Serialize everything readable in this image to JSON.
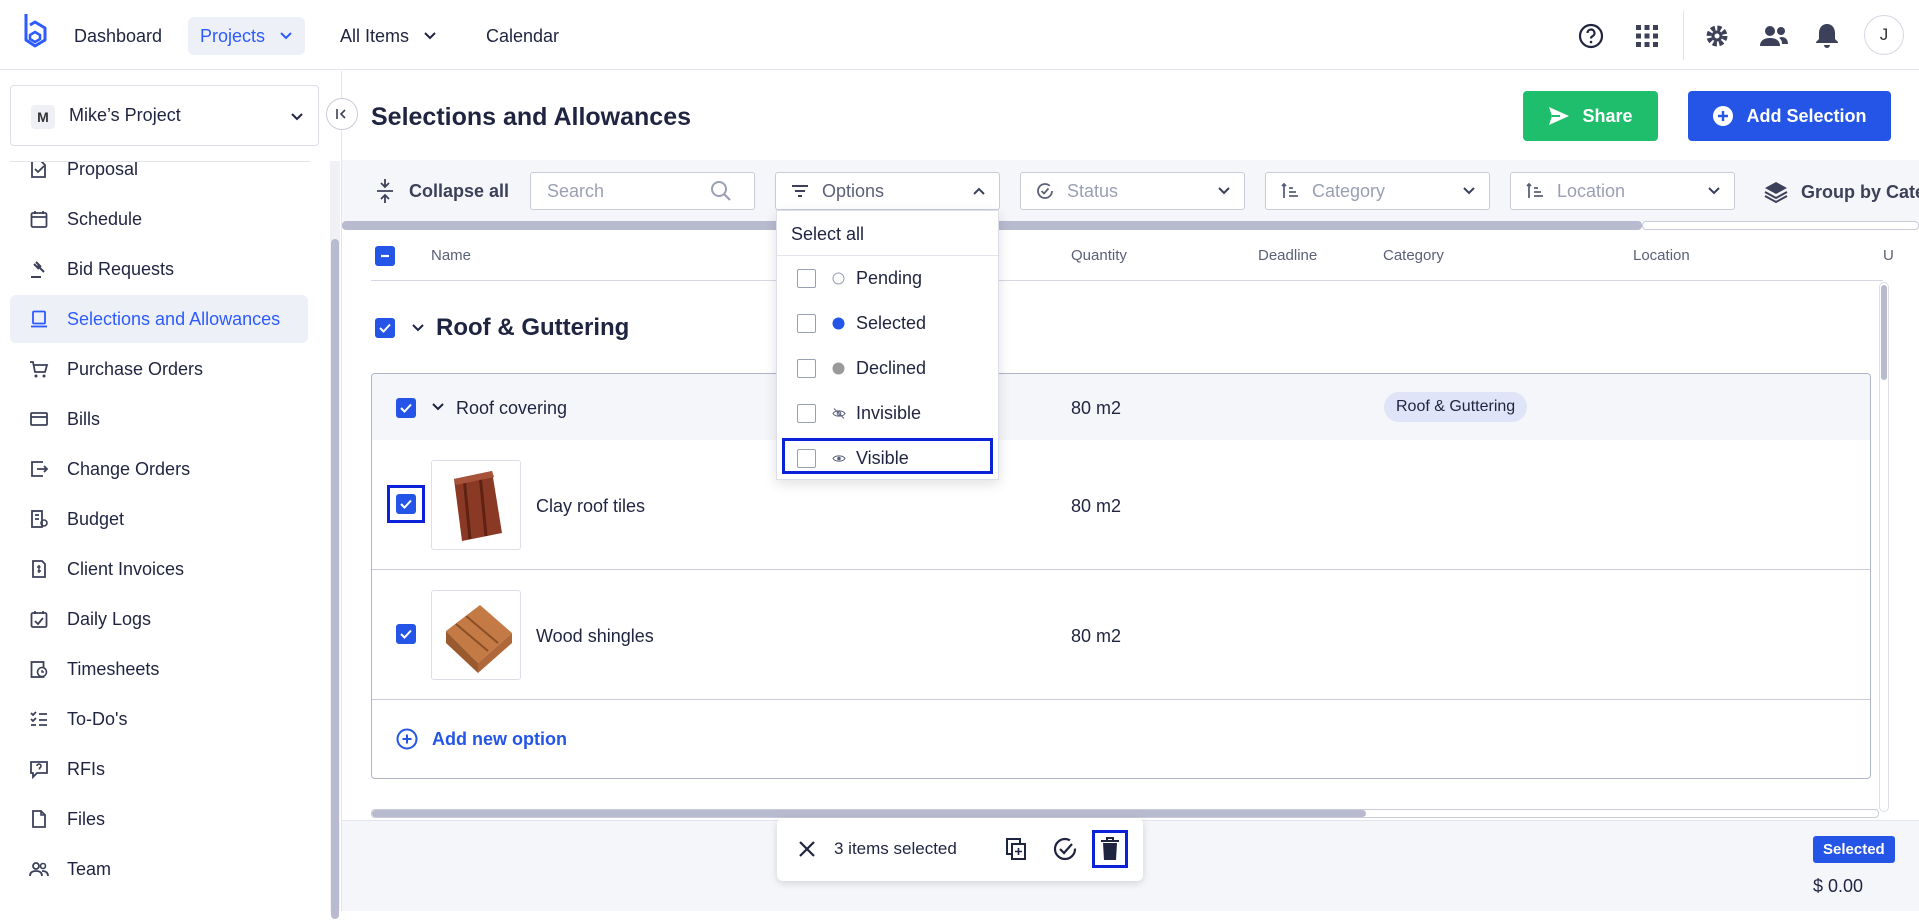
{
  "topnav": {
    "dashboard": "Dashboard",
    "projects": "Projects",
    "all_items": "All Items",
    "calendar": "Calendar",
    "avatar_initial": "J"
  },
  "sidebar": {
    "project_initial": "M",
    "project_name": "Mike’s Project",
    "items": [
      {
        "label": "Proposal",
        "icon": "proposal-icon"
      },
      {
        "label": "Schedule",
        "icon": "calendar-icon"
      },
      {
        "label": "Bid Requests",
        "icon": "gavel-icon"
      },
      {
        "label": "Selections and Allowances",
        "icon": "selections-icon",
        "active": true
      },
      {
        "label": "Purchase Orders",
        "icon": "cart-icon"
      },
      {
        "label": "Bills",
        "icon": "bills-icon"
      },
      {
        "label": "Change Orders",
        "icon": "change-order-icon"
      },
      {
        "label": "Budget",
        "icon": "budget-icon"
      },
      {
        "label": "Client Invoices",
        "icon": "invoice-icon"
      },
      {
        "label": "Daily Logs",
        "icon": "daily-log-icon"
      },
      {
        "label": "Timesheets",
        "icon": "timesheet-icon"
      },
      {
        "label": "To-Do's",
        "icon": "todo-icon"
      },
      {
        "label": "RFIs",
        "icon": "rfi-icon"
      },
      {
        "label": "Files",
        "icon": "file-icon"
      },
      {
        "label": "Team",
        "icon": "team-icon"
      }
    ]
  },
  "page": {
    "title": "Selections and Allowances",
    "share_label": "Share",
    "add_selection_label": "Add Selection"
  },
  "filters": {
    "collapse_all": "Collapse all",
    "search_placeholder": "Search",
    "options": "Options",
    "status": "Status",
    "category": "Category",
    "location": "Location",
    "group_by": "Group by Cate"
  },
  "table": {
    "columns": {
      "name": "Name",
      "quantity": "Quantity",
      "deadline": "Deadline",
      "category": "Category",
      "location": "Location",
      "extra": "U"
    },
    "group_title": "Roof & Guttering",
    "selection": {
      "name": "Roof covering",
      "quantity": "80 m2",
      "category": "Roof & Guttering"
    },
    "options": [
      {
        "name": "Clay roof tiles",
        "quantity": "80 m2"
      },
      {
        "name": "Wood shingles",
        "quantity": "80 m2"
      }
    ],
    "add_new_option": "Add new option"
  },
  "dropdown": {
    "select_all": "Select all",
    "items": [
      {
        "label": "Pending",
        "marker": "hollow-circle-icon"
      },
      {
        "label": "Selected",
        "marker": "blue-dot-icon"
      },
      {
        "label": "Declined",
        "marker": "gray-dot-icon"
      },
      {
        "label": "Invisible",
        "marker": "eye-off-icon"
      },
      {
        "label": "Visible",
        "marker": "eye-icon"
      }
    ]
  },
  "bottom": {
    "items_selected": "3 items selected",
    "status_badge": "Selected",
    "total": "$ 0.00"
  },
  "colors": {
    "accent": "#2455e6",
    "share_green": "#1fbe6c",
    "focus_outline": "#0b22d8"
  }
}
